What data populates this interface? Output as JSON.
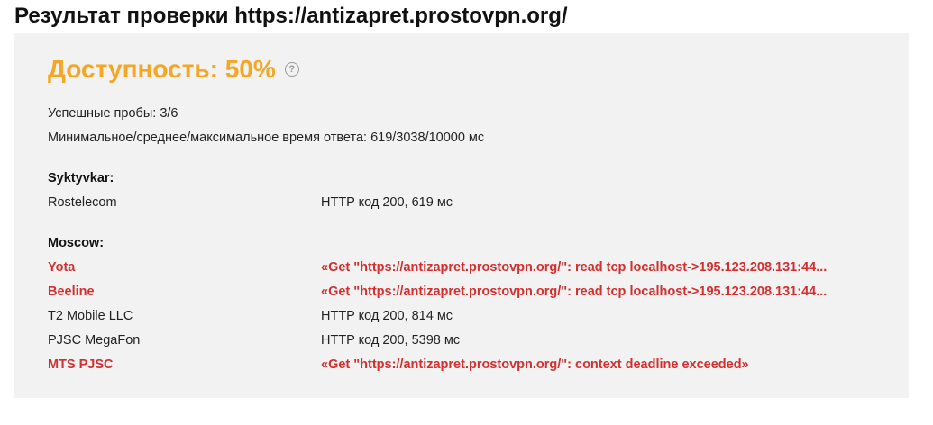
{
  "title": "Результат проверки https://antizapret.prostovpn.org/",
  "availability": {
    "label": "Доступность: 50%",
    "help_icon": "question-circle-icon",
    "color": "#f5a623"
  },
  "summary": {
    "success_probes": "Успешные пробы: 3/6",
    "response_times": "Минимальное/среднее/максимальное время ответа: 619/3038/10000 мс"
  },
  "colors": {
    "ok": "#222222",
    "fail": "#d32f2f",
    "panel_bg": "#f2f2f2"
  },
  "groups": [
    {
      "location": "Syktyvkar:",
      "rows": [
        {
          "isp": "Rostelecom",
          "result": "HTTP код 200, 619 мс",
          "status": "ok"
        }
      ]
    },
    {
      "location": "Moscow:",
      "rows": [
        {
          "isp": "Yota",
          "result": "«Get \"https://antizapret.prostovpn.org/\": read tcp localhost->195.123.208.131:44...",
          "status": "fail"
        },
        {
          "isp": "Beeline",
          "result": "«Get \"https://antizapret.prostovpn.org/\": read tcp localhost->195.123.208.131:44...",
          "status": "fail"
        },
        {
          "isp": "T2 Mobile LLC",
          "result": "HTTP код 200, 814 мс",
          "status": "ok"
        },
        {
          "isp": "PJSC MegaFon",
          "result": "HTTP код 200, 5398 мс",
          "status": "ok"
        },
        {
          "isp": "MTS PJSC",
          "result": "«Get \"https://antizapret.prostovpn.org/\": context deadline exceeded»",
          "status": "fail"
        }
      ]
    }
  ]
}
